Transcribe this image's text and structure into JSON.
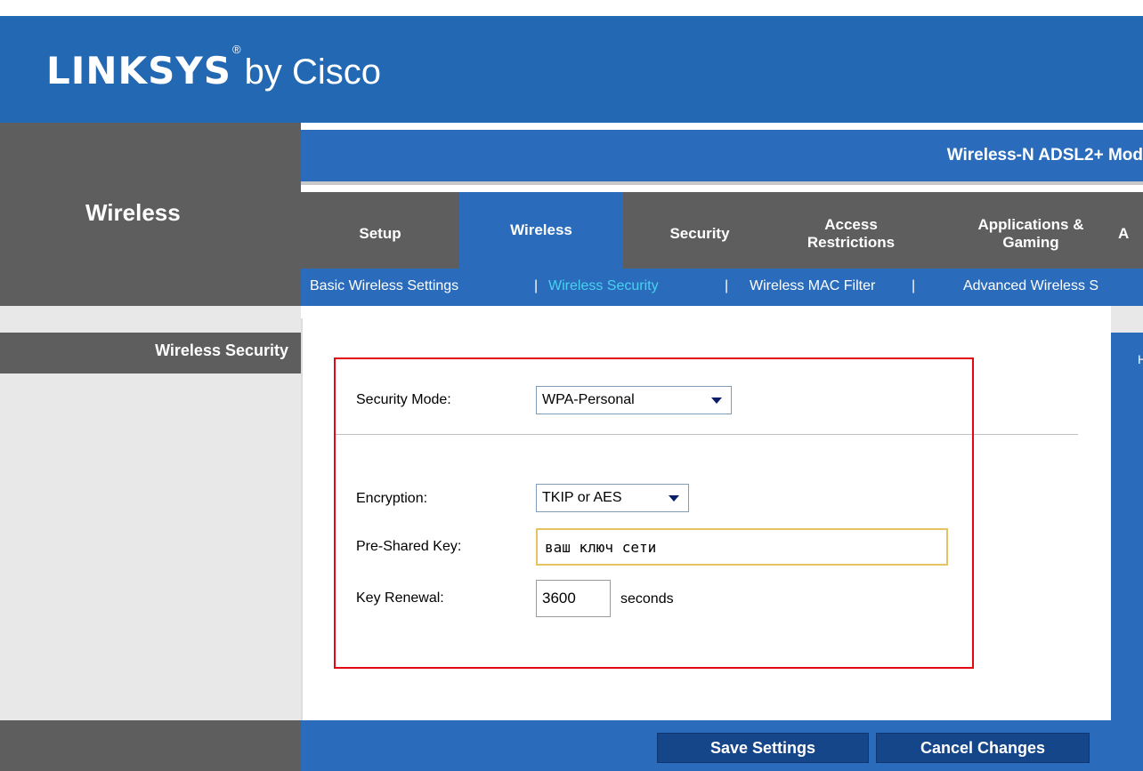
{
  "brand": {
    "name": "LINKSYS",
    "registered": "®",
    "suffix": "by Cisco"
  },
  "section_title": "Wireless",
  "model_title": "Wireless-N ADSL2+ Mod",
  "tabs": [
    {
      "label": "Setup"
    },
    {
      "label": "Wireless"
    },
    {
      "label": "Security"
    },
    {
      "label": "Access Restrictions"
    },
    {
      "label": "Applications & Gaming"
    },
    {
      "label": "A"
    }
  ],
  "subnav": {
    "items": [
      "Basic Wireless Settings",
      "Wireless Security",
      "Wireless MAC Filter",
      "Advanced Wireless S"
    ],
    "separator": "|"
  },
  "sidebar_label": "Wireless Security",
  "help_letter": "H",
  "form": {
    "security_mode_label": "Security Mode:",
    "security_mode_value": "WPA-Personal",
    "encryption_label": "Encryption:",
    "encryption_value": "TKIP or AES",
    "psk_label": "Pre-Shared Key:",
    "psk_value": "ваш ключ сети",
    "renewal_label": "Key Renewal:",
    "renewal_value": "3600",
    "renewal_unit": "seconds"
  },
  "buttons": {
    "save": "Save Settings",
    "cancel": "Cancel Changes"
  },
  "colors": {
    "brand_blue": "#2368b3",
    "nav_gray": "#5e5e5e",
    "active_link": "#48d1f0",
    "highlight_box": "#e30613"
  }
}
